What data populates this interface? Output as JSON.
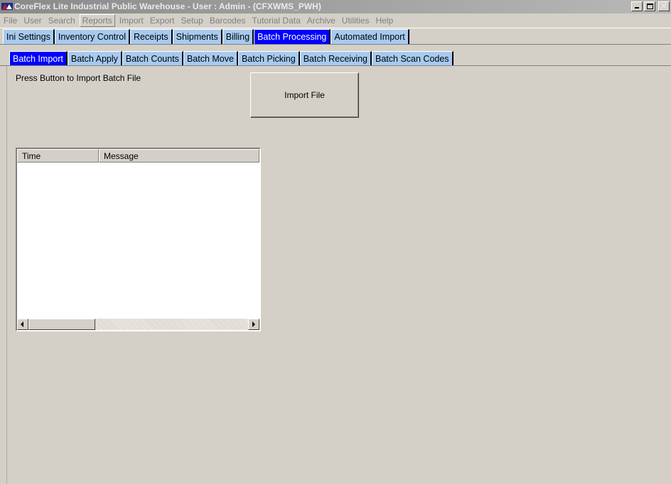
{
  "window": {
    "title": "CoreFlex Lite Industrial Public Warehouse - User : Admin - (CFXWMS_PWH)",
    "title_color": "#eaeaea",
    "controls": [
      "minimize-icon",
      "maximize-icon",
      "close-icon"
    ],
    "close_glyph": "✕"
  },
  "menubar": {
    "items": [
      "File",
      "User",
      "Search",
      "Reports",
      "Import",
      "Export",
      "Setup",
      "Barcodes",
      "Tutorial Data",
      "Archive",
      "Utilities",
      "Help"
    ],
    "selected": "Reports"
  },
  "top_tabs": {
    "items": [
      "Ini Settings",
      "Inventory Control",
      "Receipts",
      "Shipments",
      "Billing",
      "Batch Processing",
      "Automated Import"
    ],
    "active": "Batch Processing",
    "active_color": "#0000ff",
    "inactive_color": "#a6caf0"
  },
  "sub_tabs": {
    "items": [
      "Batch Import",
      "Batch Apply",
      "Batch Counts",
      "Batch Move",
      "Batch Picking",
      "Batch Receiving",
      "Batch Scan Codes"
    ],
    "active": "Batch Import"
  },
  "panel": {
    "prompt": "Press Button to Import Batch File",
    "import_button": "Import File"
  },
  "log_table": {
    "columns": [
      "Time",
      "Message"
    ],
    "rows": []
  }
}
